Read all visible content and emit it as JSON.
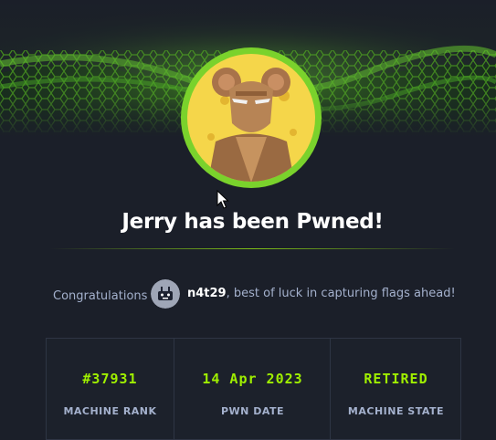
{
  "header": {
    "title": "Jerry has been Pwned!"
  },
  "congrats": {
    "label": "Congratulations",
    "username": "n4t29",
    "message": ", best of luck in capturing flags ahead!"
  },
  "stats": [
    {
      "value": "#37931",
      "label": "MACHINE RANK"
    },
    {
      "value": "14 Apr 2023",
      "label": "PWN DATE"
    },
    {
      "value": "RETIRED",
      "label": "MACHINE STATE"
    }
  ],
  "colors": {
    "accent": "#9fef00",
    "background": "#1b1f29",
    "muted_text": "#a4b1cd"
  },
  "icons": {
    "machine_avatar": "jerry-mouse-avatar",
    "user_avatar": "robot-avatar",
    "cursor": "mouse-pointer-icon"
  }
}
